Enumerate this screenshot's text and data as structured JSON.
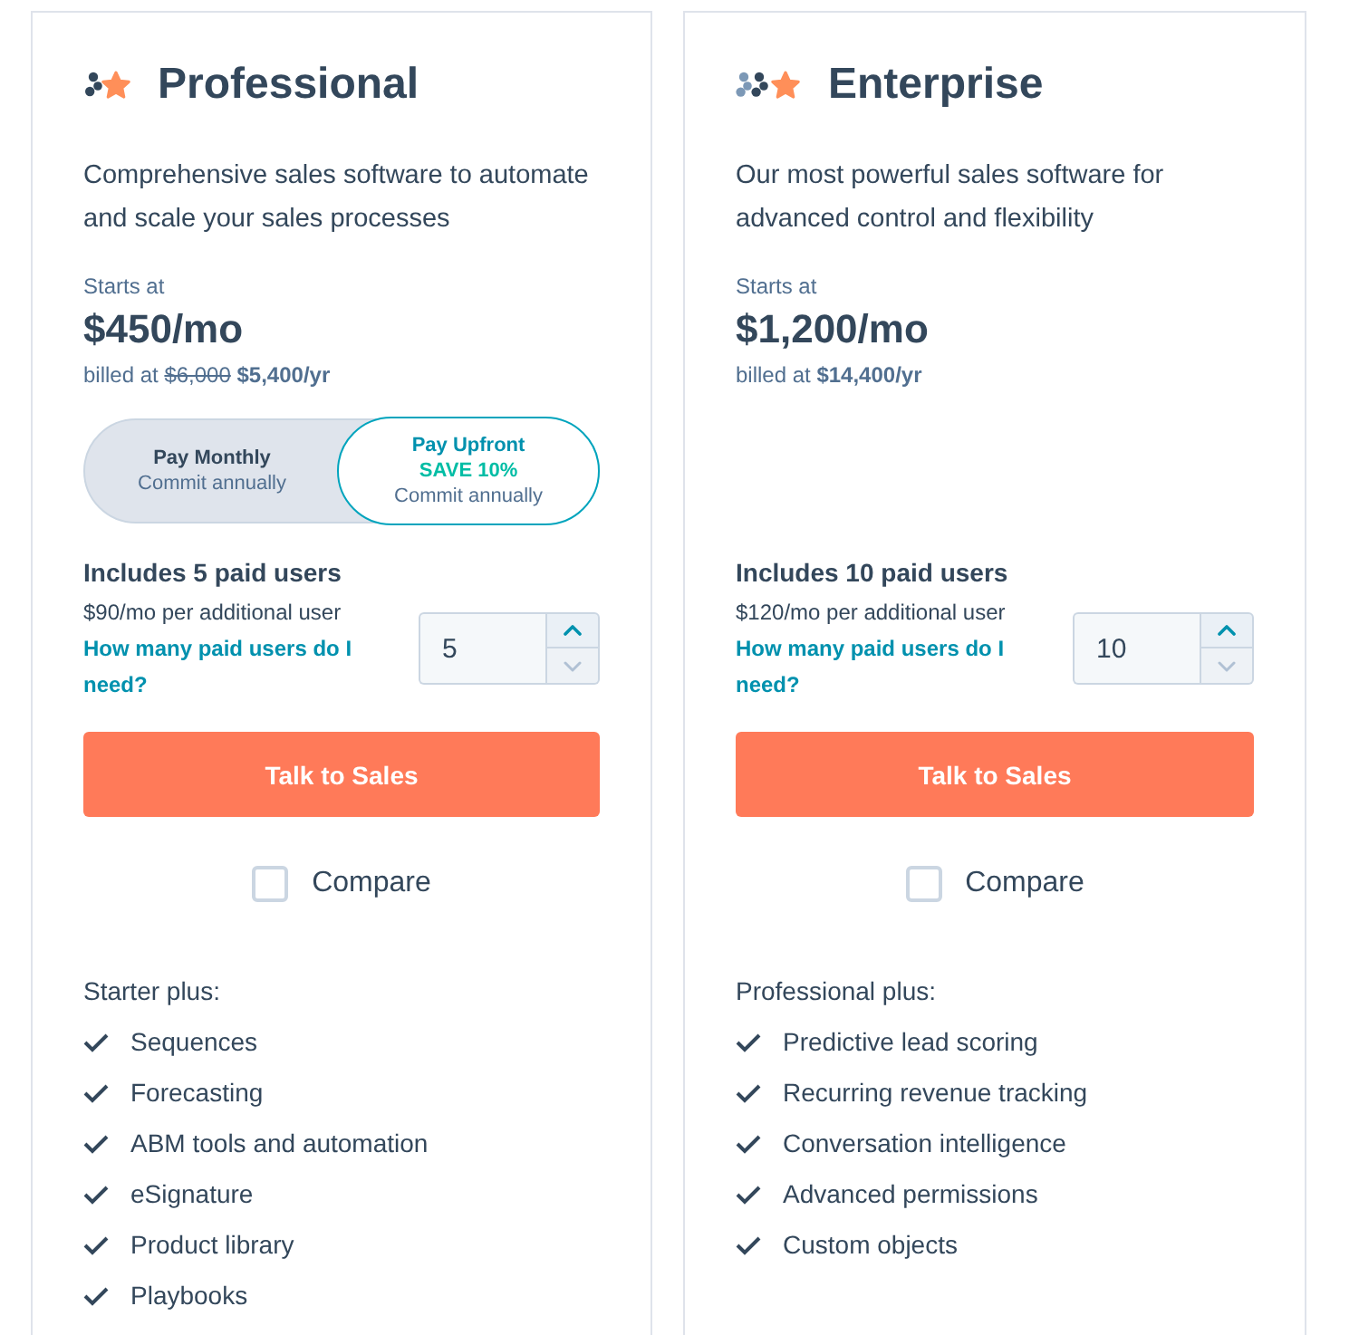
{
  "plans": [
    {
      "name": "Professional",
      "description": "Comprehensive sales software to automate and scale your sales processes",
      "starts_label": "Starts at",
      "price": "$450/mo",
      "billed_label": "billed at",
      "original_price": "$6,000",
      "billed_price": "$5,400/yr",
      "billing_options": [
        {
          "label": "Pay Monthly",
          "note": "Commit annually",
          "selected": false
        },
        {
          "label": "Pay Upfront",
          "badge": "SAVE 10%",
          "note": "Commit annually",
          "selected": true
        }
      ],
      "included_users": "Includes 5 paid users",
      "extra_user_price": "$90/mo per additional user",
      "help_link": "How many paid users do I need?",
      "user_count": {
        "value": "5",
        "decrease_disabled": true
      },
      "cta": "Talk to Sales",
      "compare": {
        "label": "Compare",
        "checked": false
      },
      "features_heading": "Starter plus:",
      "features": [
        "Sequences",
        "Forecasting",
        "ABM tools and automation",
        "eSignature",
        "Product library",
        "Playbooks"
      ]
    },
    {
      "name": "Enterprise",
      "description": "Our most powerful sales software for advanced control and flexibility",
      "starts_label": "Starts at",
      "price": "$1,200/mo",
      "billed_label": "billed at",
      "billed_price": "$14,400/yr",
      "included_users": "Includes 10 paid users",
      "extra_user_price": "$120/mo per additional user",
      "help_link": "How many paid users do I need?",
      "user_count": {
        "value": "10",
        "decrease_disabled": true
      },
      "cta": "Talk to Sales",
      "compare": {
        "label": "Compare",
        "checked": false
      },
      "features_heading": "Professional plus:",
      "features": [
        "Predictive lead scoring",
        "Recurring revenue tracking",
        "Conversation intelligence",
        "Advanced permissions",
        "Custom objects"
      ]
    }
  ]
}
